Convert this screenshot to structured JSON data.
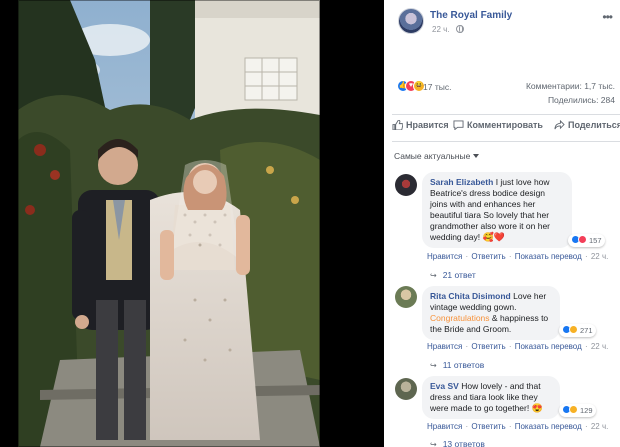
{
  "page": {
    "name": "The Royal Family",
    "time": "22 ч.",
    "more_icon": "more-horizontal-icon"
  },
  "stats": {
    "reactions": "17 тыс.",
    "comments": "Комментарии: 1,7 тыс.",
    "shares": "Поделились: 284",
    "reaction_icons": [
      "like-icon",
      "love-icon",
      "haha-icon"
    ]
  },
  "actions": {
    "like": "Нравится",
    "comment": "Комментировать",
    "share": "Поделиться"
  },
  "sort": {
    "label": "Самые актуальные"
  },
  "comments": [
    {
      "author": "Sarah Elizabeth",
      "text": "I just love how Beatrice's dress bodice design joins with and enhances her beautiful tiara  So lovely that her grandmother also wore it on her wedding day!",
      "emoji": "🥰❤️",
      "reaction_count": "157",
      "like": "Нравится",
      "reply": "Ответить",
      "translate": "Показать перевод",
      "time": "22 ч.",
      "replies": "21 ответ"
    },
    {
      "author": "Rita Chita Disimond",
      "text_before": "Love her vintage wedding gown.",
      "highlight": "Congratulations",
      "text_after": "& happiness to the Bride and Groom.",
      "reaction_count": "271",
      "like": "Нравится",
      "reply": "Ответить",
      "translate": "Показать перевод",
      "time": "22 ч.",
      "replies": "11 ответов"
    },
    {
      "author": "Eva SV",
      "text": "How lovely - and that dress and tiara look like they were made to go together!",
      "emoji": "😍",
      "reaction_count": "129",
      "like": "Нравится",
      "reply": "Ответить",
      "translate": "Показать перевод",
      "time": "22 ч.",
      "replies": "13 ответов"
    }
  ],
  "colors": {
    "link": "#385898",
    "meta": "#90949c",
    "bubble": "#f2f3f5",
    "like_blue": "#1877f2",
    "love_red": "#f33e58",
    "haha_yellow": "#f7b125"
  }
}
